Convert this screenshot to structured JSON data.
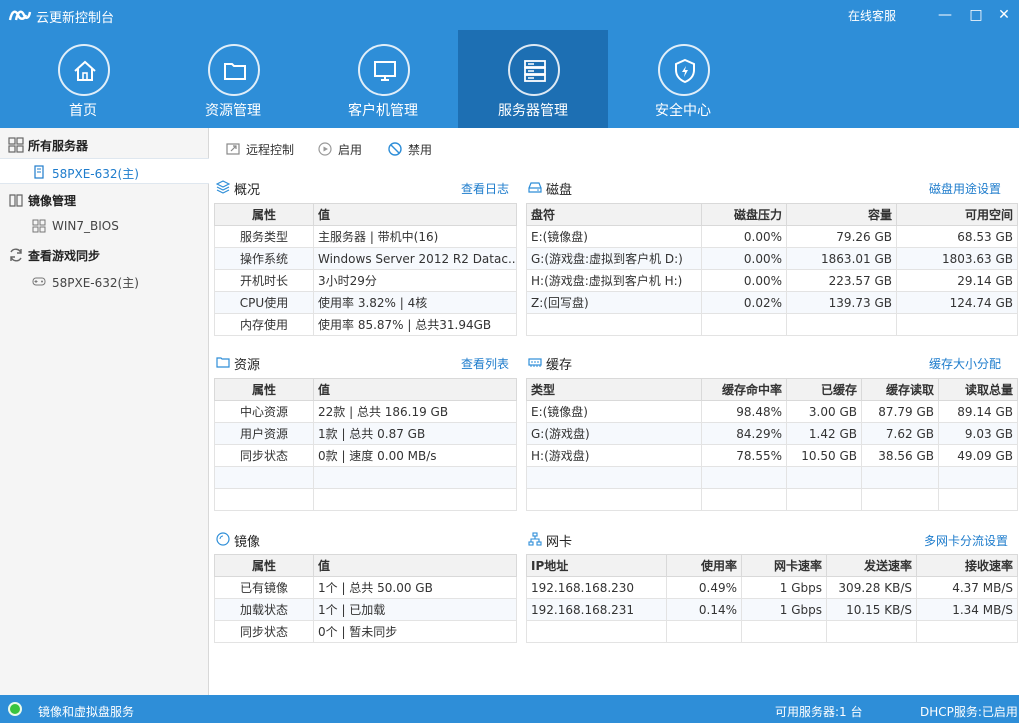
{
  "app": {
    "title": "云更新控制台",
    "service_link": "在线客服",
    "window": {
      "min": "—",
      "restore": "□",
      "close": "✕"
    }
  },
  "nav": [
    {
      "label": "首页",
      "icon": "home-icon"
    },
    {
      "label": "资源管理",
      "icon": "folder-icon"
    },
    {
      "label": "客户机管理",
      "icon": "monitor-icon"
    },
    {
      "label": "服务器管理",
      "icon": "server-icon",
      "active": true
    },
    {
      "label": "安全中心",
      "icon": "shield-icon"
    }
  ],
  "sidebar": {
    "groups": [
      {
        "label": "所有服务器",
        "icon": "grid-icon",
        "items": [
          {
            "label": "58PXE-632(主)",
            "icon": "server-small-icon",
            "selected": true
          }
        ]
      },
      {
        "label": "镜像管理",
        "icon": "book-icon",
        "items": [
          {
            "label": "WIN7_BIOS",
            "icon": "grid-small-icon"
          }
        ]
      },
      {
        "label": "查看游戏同步",
        "icon": "sync-icon",
        "items": [
          {
            "label": "58PXE-632(主)",
            "icon": "gamepad-icon"
          }
        ]
      }
    ]
  },
  "toolbar": {
    "remote": "远程控制",
    "enable": "启用",
    "disable": "禁用"
  },
  "overview": {
    "title": "概况",
    "link": "查看日志",
    "headers": [
      "属性",
      "值"
    ],
    "rows": [
      [
        "服务类型",
        "主服务器 | 带机中(16)"
      ],
      [
        "操作系统",
        "Windows Server 2012 R2 Datac..."
      ],
      [
        "开机时长",
        "3小时29分"
      ],
      [
        "CPU使用",
        "使用率 3.82% | 4核"
      ],
      [
        "内存使用",
        "使用率 85.87% | 总共31.94GB"
      ]
    ]
  },
  "disk": {
    "title": "磁盘",
    "link": "磁盘用途设置",
    "headers": [
      "盘符",
      "磁盘压力",
      "容量",
      "可用空间"
    ],
    "rows": [
      [
        "E:(镜像盘)",
        "0.00%",
        "79.26 GB",
        "68.53 GB"
      ],
      [
        "G:(游戏盘:虚拟到客户机 D:)",
        "0.00%",
        "1863.01 GB",
        "1803.63 GB"
      ],
      [
        "H:(游戏盘:虚拟到客户机 H:)",
        "0.00%",
        "223.57 GB",
        "29.14 GB"
      ],
      [
        "Z:(回写盘)",
        "0.02%",
        "139.73 GB",
        "124.74 GB"
      ]
    ]
  },
  "resource": {
    "title": "资源",
    "link": "查看列表",
    "headers": [
      "属性",
      "值"
    ],
    "rows": [
      [
        "中心资源",
        "22款 | 总共 186.19 GB"
      ],
      [
        "用户资源",
        "1款 | 总共 0.87 GB"
      ],
      [
        "同步状态",
        "0款 | 速度 0.00 MB/s"
      ]
    ]
  },
  "cache": {
    "title": "缓存",
    "link": "缓存大小分配",
    "headers": [
      "类型",
      "缓存命中率",
      "已缓存",
      "缓存读取",
      "读取总量"
    ],
    "rows": [
      [
        "E:(镜像盘)",
        "98.48%",
        "3.00 GB",
        "87.79 GB",
        "89.14 GB"
      ],
      [
        "G:(游戏盘)",
        "84.29%",
        "1.42 GB",
        "7.62 GB",
        "9.03 GB"
      ],
      [
        "H:(游戏盘)",
        "78.55%",
        "10.50 GB",
        "38.56 GB",
        "49.09 GB"
      ]
    ]
  },
  "image": {
    "title": "镜像",
    "headers": [
      "属性",
      "值"
    ],
    "rows": [
      [
        "已有镜像",
        "1个 | 总共 50.00 GB"
      ],
      [
        "加载状态",
        "1个 | 已加载"
      ],
      [
        "同步状态",
        "0个 | 暂未同步"
      ]
    ]
  },
  "nic": {
    "title": "网卡",
    "link": "多网卡分流设置",
    "headers": [
      "IP地址",
      "使用率",
      "网卡速率",
      "发送速率",
      "接收速率"
    ],
    "rows": [
      [
        "192.168.168.230",
        "0.49%",
        "1 Gbps",
        "309.28 KB/S",
        "4.37 MB/S"
      ],
      [
        "192.168.168.231",
        "0.14%",
        "1 Gbps",
        "10.15 KB/S",
        "1.34 MB/S"
      ]
    ]
  },
  "status": {
    "service": "镜像和虚拟盘服务",
    "available": "可用服务器:1 台",
    "dhcp": "DHCP服务:已启用"
  },
  "colors": {
    "accent": "#2e8ed8",
    "nav_active": "#1d6fb3",
    "link": "#1e7ccc"
  }
}
